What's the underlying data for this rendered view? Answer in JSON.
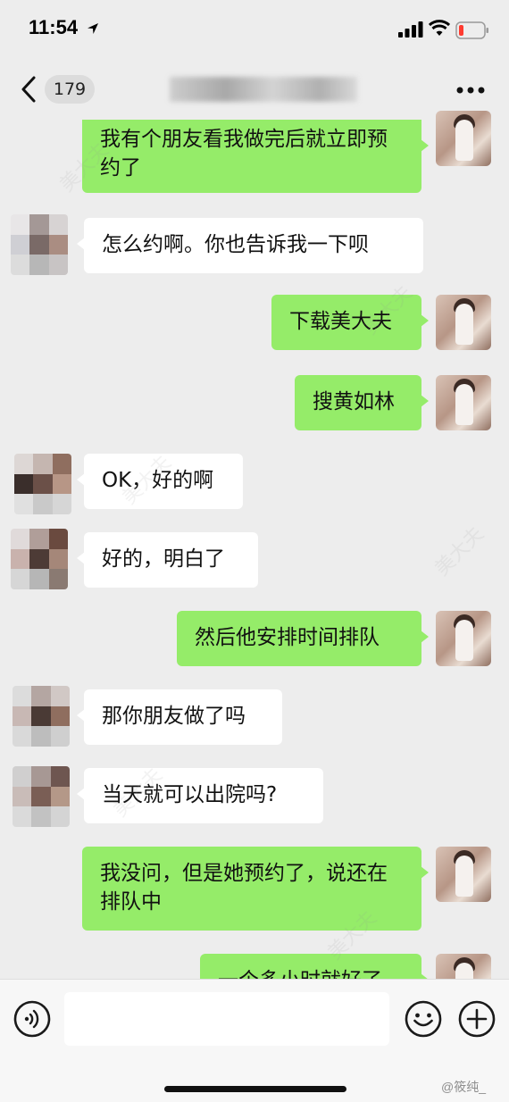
{
  "status_bar": {
    "time": "11:54",
    "location_icon": "location-arrow-icon",
    "signal_icon": "cellular-signal-icon",
    "wifi_icon": "wifi-icon",
    "battery_icon": "battery-low-icon",
    "battery_color": "#ff3b30"
  },
  "nav": {
    "back_icon": "chevron-left-icon",
    "unread_count": "179",
    "more_icon": "more-dots-icon"
  },
  "colors": {
    "outgoing_bubble": "#95ec69",
    "incoming_bubble": "#ffffff",
    "chat_background": "#ededed"
  },
  "messages": [
    {
      "direction": "out",
      "text": "我有个朋友看我做完后就立即预约了"
    },
    {
      "direction": "in",
      "text": "怎么约啊。你也告诉我一下呗"
    },
    {
      "direction": "out",
      "text": "下载美大夫"
    },
    {
      "direction": "out",
      "text": "搜黄如林"
    },
    {
      "direction": "in",
      "text": "OK，好的啊"
    },
    {
      "direction": "in",
      "text": "好的，明白了"
    },
    {
      "direction": "out",
      "text": "然后他安排时间排队"
    },
    {
      "direction": "in",
      "text": "那你朋友做了吗"
    },
    {
      "direction": "in",
      "text": "当天就可以出院吗?"
    },
    {
      "direction": "out",
      "text": "我没问，但是她预约了，说还在排队中"
    },
    {
      "direction": "out",
      "text": "一个多小时就好了"
    }
  ],
  "input_bar": {
    "voice_icon": "voice-icon",
    "emoji_icon": "emoji-icon",
    "plus_icon": "plus-icon",
    "input_value": ""
  },
  "watermark": "美大夫",
  "weibo_watermark": "@筱纯_"
}
